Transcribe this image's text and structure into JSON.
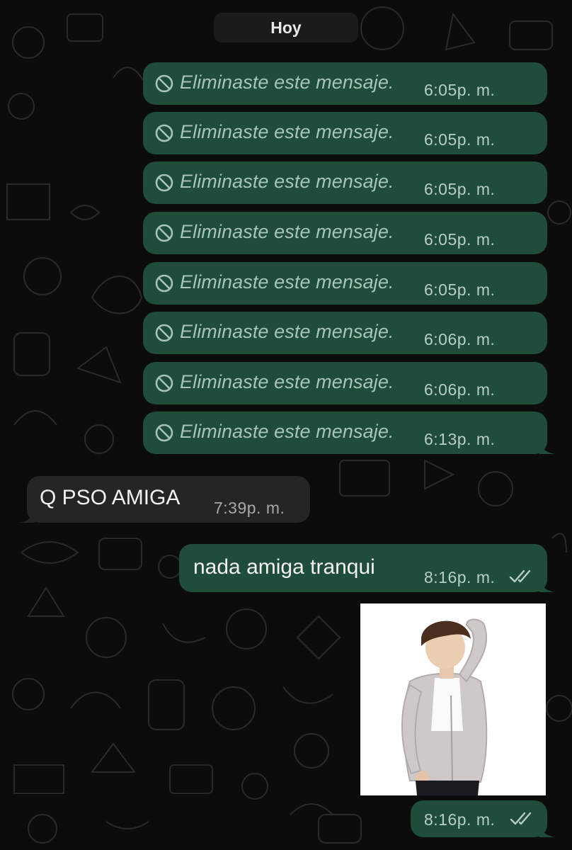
{
  "date_separator": "Hoy",
  "deleted_messages": [
    {
      "text": "Eliminaste este mensaje.",
      "time": "6:05",
      "period": "p. m."
    },
    {
      "text": "Eliminaste este mensaje.",
      "time": "6:05",
      "period": "p. m."
    },
    {
      "text": "Eliminaste este mensaje.",
      "time": "6:05",
      "period": "p. m."
    },
    {
      "text": "Eliminaste este mensaje.",
      "time": "6:05",
      "period": "p. m."
    },
    {
      "text": "Eliminaste este mensaje.",
      "time": "6:05",
      "period": "p. m."
    },
    {
      "text": "Eliminaste este mensaje.",
      "time": "6:06",
      "period": "p. m."
    },
    {
      "text": "Eliminaste este mensaje.",
      "time": "6:06",
      "period": "p. m."
    },
    {
      "text": "Eliminaste este mensaje.",
      "time": "6:13",
      "period": "p. m."
    }
  ],
  "incoming_message": {
    "text": "Q PSO AMIGA",
    "time": "7:39",
    "period": "p. m."
  },
  "outgoing_message": {
    "text": "nada amiga tranqui",
    "time": "8:16",
    "period": "p. m.",
    "status": "read"
  },
  "photo_message": {
    "time": "8:16",
    "period": "p. m.",
    "status": "read",
    "icon": "photo-person-icon"
  },
  "colors": {
    "outgoing_bubble": "#1f4d39",
    "incoming_bubble": "#252525",
    "background": "#0c0c0c",
    "read_ticks": "#b9cdc3"
  }
}
